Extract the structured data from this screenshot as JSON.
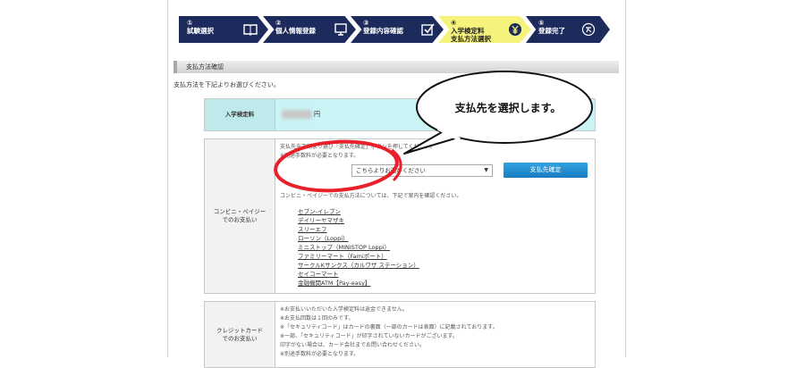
{
  "steps": [
    {
      "num": "①",
      "label": "試験選択",
      "icon": "book-icon"
    },
    {
      "num": "②",
      "label": "個人情報登録",
      "icon": "monitor-icon"
    },
    {
      "num": "③",
      "label": "登録内容確認",
      "icon": "checkbox-icon"
    },
    {
      "num": "④",
      "label": "入学検定料",
      "label2": "支払方法選択",
      "icon": "yen-icon"
    },
    {
      "num": "⑤",
      "label": "登録完了",
      "icon": "complete-icon"
    }
  ],
  "colors": {
    "step_bg": "#1d2a5c",
    "step_active_bg": "#f5f37b",
    "section_accent": "#a8a8a8",
    "fee_row_bg": "#c9f3f5",
    "fee_label_bg": "#bfeaeb",
    "button_bg": "#1f8fd6",
    "circle_red": "#e8202a"
  },
  "section_title": "支払方法確認",
  "intro": "支払方法を下記よりお選びください。",
  "fee": {
    "label": "入学検定料",
    "amount": "円"
  },
  "convenience": {
    "label": "コンビニ・ペイジー",
    "label2": "でのお支払い",
    "note1": "支払先を下記より選び「支払先確定」ボタンを押してください。",
    "note2": "※別途手数料が必要となります。",
    "select_value": "こちらよりお選びください",
    "confirm_button": "支払先確定",
    "note3": "コンビニ・ペイジーでの支払方法については、下記で案内を確認ください。",
    "links": [
      "セブン-イレブン",
      "デイリーヤマザキ",
      "スリーエフ",
      "ローソン（Loppi）",
      "ミニストップ（MINISTOP Loppi）",
      "ファミリーマート（Famiポート）",
      "サークルKサンクス（カルワザ ステーション）",
      "セイコーマート",
      "金融機関ATM【Pay-easy】"
    ]
  },
  "credit": {
    "label": "クレジットカード",
    "label2": "でのお支払い",
    "notes": [
      "※お支払いいただいた入学検定料は返金できません。",
      "※お支払回数は１回のみです。",
      "※「セキュリティコード」はカードの裏面（一部のカードは表面）に記載されております。",
      "※一部、「セキュリティコード」が印字されていないカードがございます。",
      "印字がない場合は、カード会社までお問い合わせください。",
      "※別途手数料が必要となります。"
    ]
  },
  "callout": "支払先を選択します。"
}
